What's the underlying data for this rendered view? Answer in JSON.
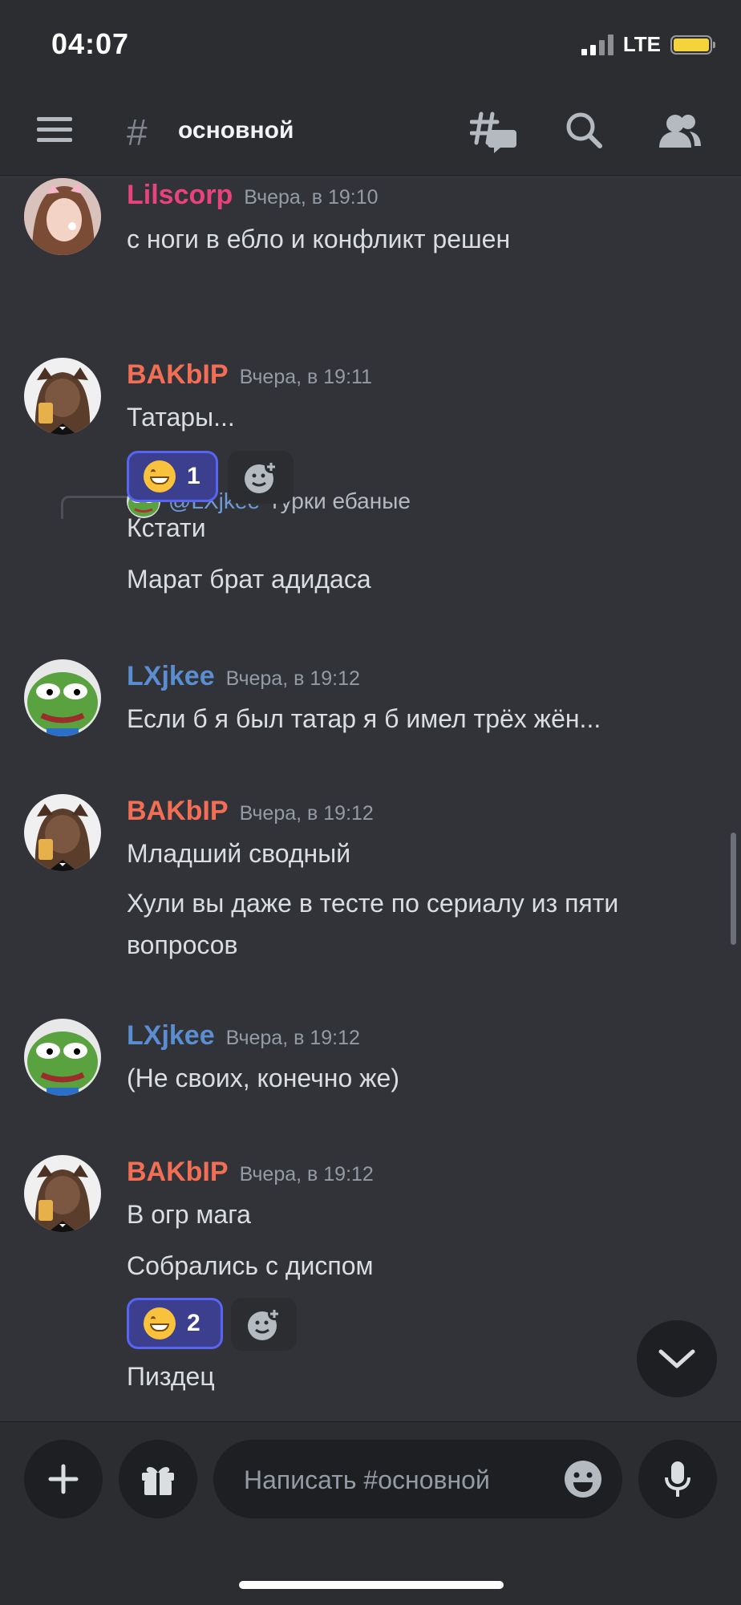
{
  "status": {
    "time": "04:07",
    "network": "LTE"
  },
  "header": {
    "channel_name": "основной",
    "icons": [
      "menu-icon",
      "hash-icon",
      "threads-icon",
      "search-icon",
      "members-icon"
    ]
  },
  "messages": [
    {
      "author": "Lilscorp",
      "author_color": "#e8437a",
      "timestamp": "Вчера, в 19:10",
      "lines": [
        "с ноги в ебло и конфликт решен"
      ],
      "avatar": "girl-avatar"
    },
    {
      "reply_to": {
        "mention": "@LXjkee",
        "text": "Турки ебаные"
      },
      "author": "ВАКЫР",
      "author_display": "BAKbIP",
      "author_color": "#f26e55",
      "timestamp": "Вчера, в 19:11",
      "lines": [
        "Татары...",
        "Кстати",
        "Марат брат адидаса"
      ],
      "reaction": {
        "emoji": "grinning-face",
        "count": "1"
      },
      "avatar": "cat-avatar"
    },
    {
      "author": "LXjkee",
      "author_color": "#5a8ed1",
      "timestamp": "Вчера, в 19:12",
      "lines": [
        "Если б я был татар я б имел трёх жён..."
      ],
      "avatar": "pepe-avatar"
    },
    {
      "author_display": "BAKbIP",
      "author_color": "#f26e55",
      "timestamp": "Вчера, в 19:12",
      "lines": [
        "Младший сводный",
        "Хули вы даже в тесте по сериалу из пяти вопросов"
      ],
      "avatar": "cat-avatar"
    },
    {
      "author": "LXjkee",
      "author_color": "#5a8ed1",
      "timestamp": "Вчера, в 19:12",
      "lines": [
        "(Не своих, конечно же)"
      ],
      "avatar": "pepe-avatar"
    },
    {
      "author_display": "BAKbIP",
      "author_color": "#f26e55",
      "timestamp": "Вчера, в 19:12",
      "lines": [
        "В огр мага",
        "Собрались с диспом",
        "Пиздец"
      ],
      "reaction": {
        "emoji": "grinning-face",
        "count": "2"
      },
      "avatar": "cat-avatar"
    }
  ],
  "composer": {
    "placeholder": "Написать #основной"
  },
  "colors": {
    "background": "#313338",
    "bar": "#2b2d31",
    "accent": "#5865f2"
  }
}
